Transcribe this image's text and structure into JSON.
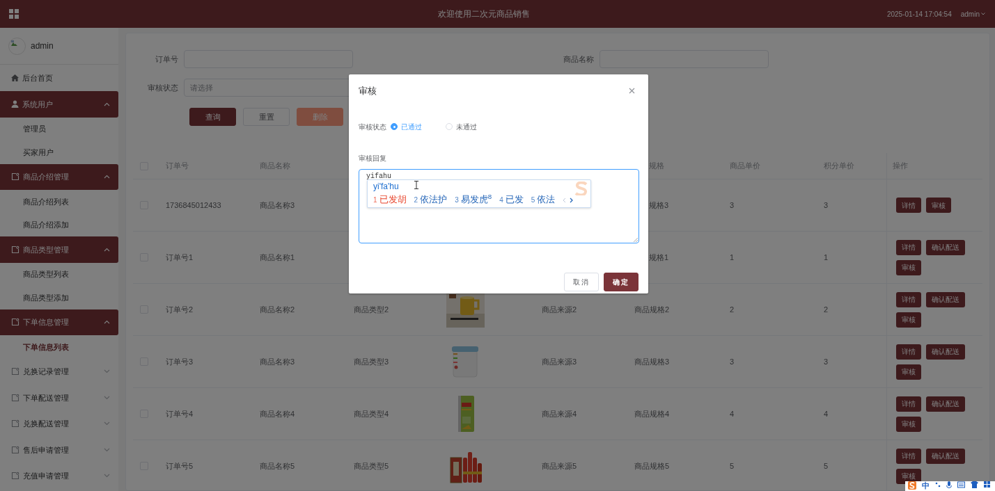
{
  "header": {
    "title": "欢迎使用二次元商品销售",
    "datetime": "2025-01-14 17:04:54",
    "user": "admin"
  },
  "sidebar": {
    "user": "admin",
    "items": [
      {
        "kind": "link",
        "label": "后台首页"
      },
      {
        "kind": "group",
        "label": "系统用户",
        "expanded": true,
        "children": [
          {
            "label": "管理员",
            "selected": false
          },
          {
            "label": "买家用户",
            "selected": false
          }
        ]
      },
      {
        "kind": "group",
        "label": "商品介绍管理",
        "expanded": true,
        "children": [
          {
            "label": "商品介绍列表",
            "selected": false
          },
          {
            "label": "商品介绍添加",
            "selected": false
          }
        ]
      },
      {
        "kind": "group",
        "label": "商品类型管理",
        "expanded": true,
        "children": [
          {
            "label": "商品类型列表",
            "selected": false
          },
          {
            "label": "商品类型添加",
            "selected": false
          }
        ]
      },
      {
        "kind": "group",
        "label": "下单信息管理",
        "expanded": true,
        "children": [
          {
            "label": "下单信息列表",
            "selected": true
          }
        ]
      },
      {
        "kind": "group",
        "label": "兑换记录管理",
        "expanded": false
      },
      {
        "kind": "group",
        "label": "下单配送管理",
        "expanded": false
      },
      {
        "kind": "group",
        "label": "兑换配送管理",
        "expanded": false
      },
      {
        "kind": "group",
        "label": "售后申请管理",
        "expanded": false
      },
      {
        "kind": "group",
        "label": "充值申请管理",
        "expanded": false
      }
    ]
  },
  "search": {
    "fields": [
      {
        "label": "订单号"
      },
      {
        "label": "商品名称"
      },
      {
        "label": "审核状态",
        "placeholder": "请选择"
      }
    ],
    "buttons": [
      {
        "label": "查询",
        "kind": "primary"
      },
      {
        "label": "重置",
        "kind": "default"
      },
      {
        "label": "删除",
        "kind": "danger"
      }
    ]
  },
  "table": {
    "header_checked": false,
    "columns": [
      "订单号",
      "商品名称",
      "规格",
      "商品单价",
      "积分单价",
      "操作"
    ],
    "rows": [
      {
        "checked": false,
        "order": "1736845012433",
        "name": "商品名称3",
        "spec": "规格3",
        "price": "3",
        "points": "3",
        "actions": [
          "详情",
          "审核"
        ]
      },
      {
        "checked": false,
        "order": "订单号1",
        "name": "商品名称1",
        "spec": "规格1",
        "price": "1",
        "points": "1",
        "actions": [
          "详情",
          "确认配送",
          "审核"
        ]
      },
      {
        "checked": false,
        "order": "订单号2",
        "name": "商品名称2",
        "type": "商品类型2",
        "source": "商品来源2",
        "spec": "商品规格2",
        "price": "2",
        "points": "2",
        "actions": [
          "详情",
          "确认配送",
          "审核"
        ]
      },
      {
        "checked": false,
        "order": "订单号3",
        "name": "商品名称3",
        "type": "商品类型3",
        "source": "商品来源3",
        "spec": "商品规格3",
        "price": "3",
        "points": "3",
        "actions": [
          "详情",
          "确认配送",
          "审核"
        ]
      },
      {
        "checked": false,
        "order": "订单号4",
        "name": "商品名称4",
        "type": "商品类型4",
        "source": "商品来源4",
        "spec": "商品规格4",
        "price": "4",
        "points": "4",
        "actions": [
          "详情",
          "确认配送",
          "审核"
        ]
      },
      {
        "checked": false,
        "order": "订单号5",
        "name": "商品名称5",
        "type": "商品类型5",
        "source": "商品来源5",
        "spec": "商品规格5",
        "price": "5",
        "points": "5",
        "actions": [
          "详情",
          "确认配送",
          "审核"
        ]
      }
    ]
  },
  "dialog": {
    "title": "审核",
    "status_label": "审核状态",
    "options": [
      {
        "label": "已通过",
        "selected": true
      },
      {
        "label": "未通过",
        "selected": false
      }
    ],
    "reply_label": "审核回复",
    "reply_value": "yifahu",
    "ime": {
      "composition": "yi'fa'hu",
      "candidates": [
        {
          "index": "1",
          "text": "已发胡",
          "selected": true
        },
        {
          "index": "2",
          "text": "依法护",
          "selected": false
        },
        {
          "index": "3",
          "text": "易发虎$^{8}$",
          "selected": false
        },
        {
          "index": "4",
          "text": "已发",
          "selected": false
        },
        {
          "index": "5",
          "text": "依法",
          "selected": false
        }
      ]
    },
    "buttons": [
      {
        "label": "取消",
        "kind": "default"
      },
      {
        "label": "确定",
        "kind": "primary"
      }
    ]
  },
  "ime_toolbar": {
    "mode": "中"
  }
}
